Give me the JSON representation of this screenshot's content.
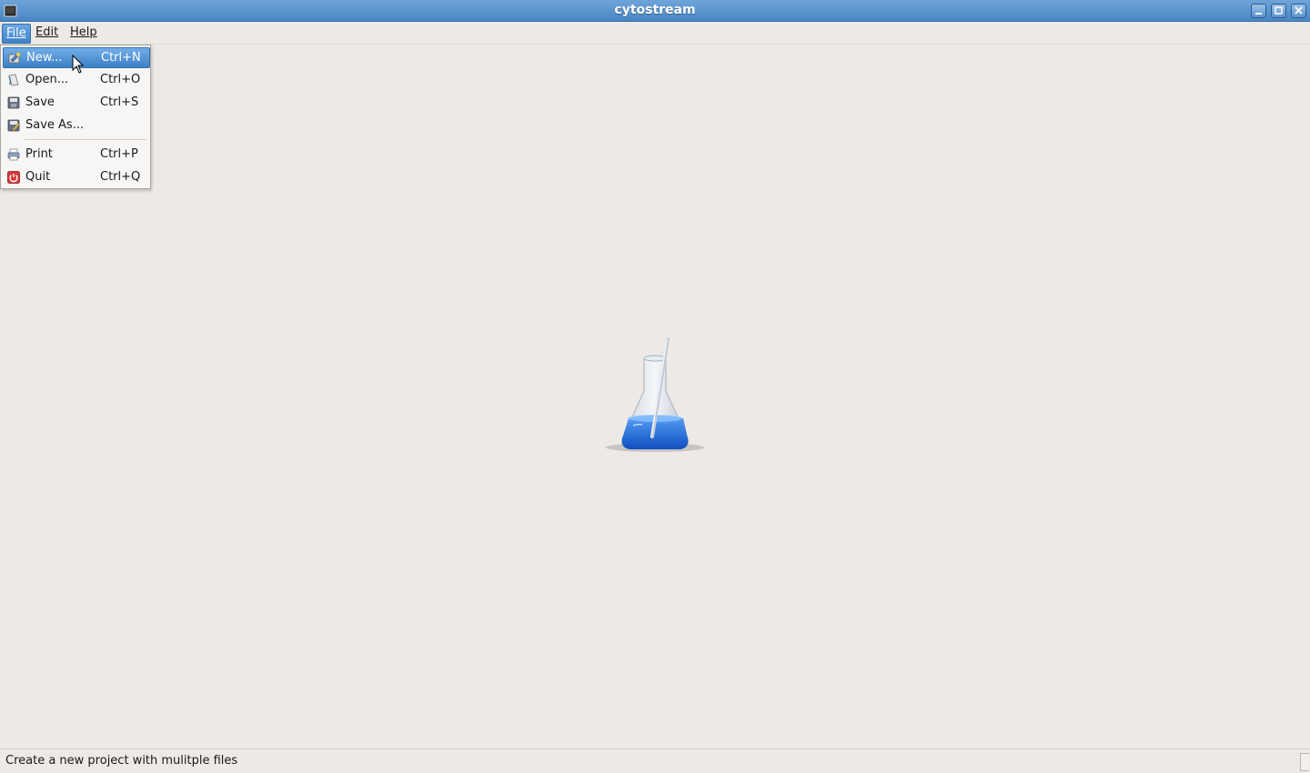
{
  "window": {
    "title": "cytostream",
    "title_color": "#4a86c5"
  },
  "menubar": {
    "items": [
      {
        "label": "File",
        "active": true
      },
      {
        "label": "Edit",
        "active": false
      },
      {
        "label": "Help",
        "active": false
      }
    ]
  },
  "file_menu": {
    "items": [
      {
        "label": "New...",
        "shortcut": "Ctrl+N",
        "icon": "new-project-icon",
        "highlighted": true
      },
      {
        "label": "Open...",
        "shortcut": "Ctrl+O",
        "icon": "open-icon",
        "highlighted": false
      },
      {
        "label": "Save",
        "shortcut": "Ctrl+S",
        "icon": "save-icon",
        "highlighted": false
      },
      {
        "label": "Save As...",
        "shortcut": "",
        "icon": "save-as-icon",
        "highlighted": false
      },
      {
        "label": "Print",
        "shortcut": "Ctrl+P",
        "icon": "print-icon",
        "highlighted": false
      },
      {
        "label": "Quit",
        "shortcut": "Ctrl+Q",
        "icon": "quit-icon",
        "highlighted": false
      }
    ]
  },
  "center_logo": {
    "icon": "flask-icon",
    "liquid_color": "#1f66d6"
  },
  "statusbar": {
    "message": "Create a new project with mulitple files"
  }
}
